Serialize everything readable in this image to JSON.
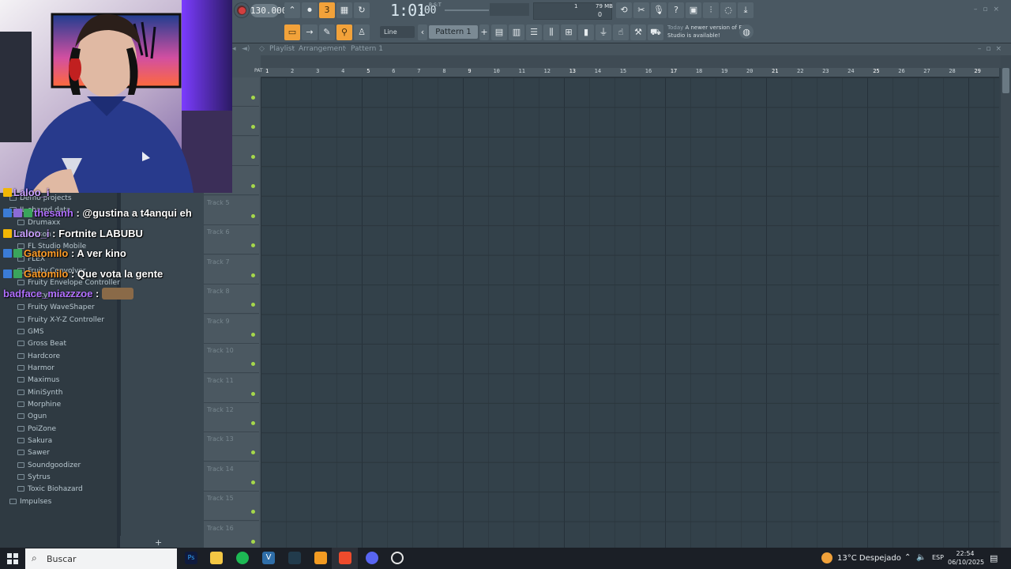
{
  "toolbar": {
    "tempo": "130.000",
    "time": "1:01",
    "time_sub": ":00",
    "time_mode": "B:S:T",
    "pattern": "Pattern 1",
    "snap": "Line",
    "memory": "79 MB",
    "monitor_value": "1",
    "cpu_value": "0",
    "news_when": "Today",
    "news_text": "A newer version of FL Studio is available!"
  },
  "playlist": {
    "window_title_prefix": "Playlist",
    "window_title_sep": "·",
    "window_title_arrangement": "Arrangement",
    "window_title_pattern": "Pattern 1",
    "ruler": [
      "1",
      "2",
      "3",
      "4",
      "5",
      "6",
      "7",
      "8",
      "9",
      "10",
      "11",
      "12",
      "13",
      "14",
      "15",
      "16",
      "17",
      "18",
      "19",
      "20",
      "21",
      "22",
      "23",
      "24",
      "25",
      "26",
      "27",
      "28",
      "29"
    ],
    "ruler_corner": "PAT",
    "tracks": [
      "",
      "",
      "",
      "",
      "Track 5",
      "Track 6",
      "Track 7",
      "Track 8",
      "Track 9",
      "Track 10",
      "Track 11",
      "Track 12",
      "Track 13",
      "Track 14",
      "Track 15",
      "Track 16"
    ]
  },
  "browser": {
    "items": [
      "Demo projects",
      "IL shared data",
      "Drumaxx",
      "Edison",
      "FL Studio Mobile",
      "FLEX",
      "Fruity Convolver",
      "Fruity Envelope Controller",
      "Fruity Love Philter",
      "Fruity WaveShaper",
      "Fruity X-Y-Z Controller",
      "GMS",
      "Gross Beat",
      "Hardcore",
      "Harmor",
      "Maximus",
      "MiniSynth",
      "Morphine",
      "Ogun",
      "PoiZone",
      "Sakura",
      "Sawer",
      "Soundgoodizer",
      "Sytrus",
      "Toxic Biohazard",
      "Impulses"
    ],
    "add_label": "+"
  },
  "chat": [
    {
      "user": "Laloo_i",
      "color": "#c9a0ff",
      "msg": ""
    },
    {
      "user": "thesanh",
      "color": "#b070ff",
      "msg": " : @gustina a t4anqui eh"
    },
    {
      "user": "Laloo_i",
      "color": "#c9a0ff",
      "msg": " : Fortnite LABUBU"
    },
    {
      "user": "Gatomilo",
      "color": "#ff9c27",
      "msg": " : A ver kino"
    },
    {
      "user": "Gatomilo",
      "color": "#ff9c27",
      "msg": " : Que vota la gente"
    },
    {
      "user": "badface_miazzzoe",
      "color": "#b070ff",
      "msg": " : "
    }
  ],
  "taskbar": {
    "search": "Buscar",
    "weather": "13°C  Despejado",
    "lang": "ESP",
    "time": "22:54",
    "date": "06/10/2025"
  },
  "colors": {
    "accent": "#f2a23a",
    "led": "#a6d84b",
    "grid_bg": "#33414a"
  }
}
